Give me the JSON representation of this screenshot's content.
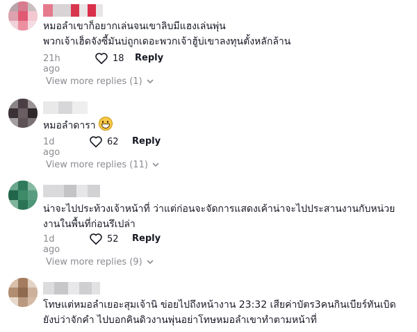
{
  "comments": [
    {
      "lines": [
        "หมอลำเขาก็อยากเล่นจนเขาลิบมีแฮงเล่นพุ่น",
        "พวกเจ้าเฮ็ดจังซี้มันบ่ถูกเดอะพวกเจ้าฮู้บ่เขาลงทุนตั้งหลักล้าน"
      ],
      "time": "21h ago",
      "likes": "18",
      "reply_label": "Reply",
      "view_more": "View more replies (1)"
    },
    {
      "lines": [
        "หมอลำดารา"
      ],
      "time": "1d ago",
      "likes": "62",
      "reply_label": "Reply",
      "view_more": "View more replies (11)"
    },
    {
      "lines": [
        "น่าจะไปประท้วงเจ้าหน้าที่ ว่าแต่ก่อนจะจัดการแสดงเค้าน่าจะไปประสานงานกับหน่วย",
        "งานในพื้นที่ก่อนรึเปล่า"
      ],
      "time": "1d ago",
      "likes": "52",
      "reply_label": "Reply",
      "view_more": "View more replies (9)"
    },
    {
      "lines": [
        "โทษแต่หมอลำเยอะสุมเจ้านิ ข่อยไปถึงหน้างาน 23:32 เสียค่าบัตร3คนกินเบียร์ทันเบิด",
        "ยังบ่ว่าจักคำ ไปบอกคินดิวงานพุ่นอย่าโทษหมอลำเขาทำตามหน้าที่"
      ]
    }
  ],
  "icons": {
    "like": "heart-outline-icon",
    "chevron": "chevron-down-icon",
    "emoji": "grinning-face-emoji"
  },
  "colors": {
    "text": "#161823",
    "muted": "#8a8b91"
  }
}
